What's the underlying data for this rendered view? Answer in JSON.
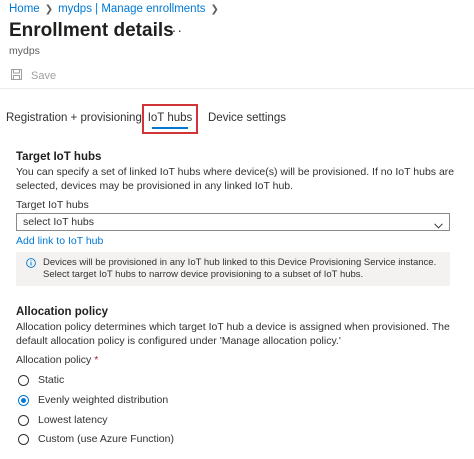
{
  "breadcrumb": {
    "home": "Home",
    "resource": "mydps | Manage enrollments"
  },
  "page": {
    "title": "Enrollment details",
    "more": "···",
    "subtitle": "mydps"
  },
  "toolbar": {
    "save_label": "Save"
  },
  "tabs": [
    {
      "label": "Registration + provisioning"
    },
    {
      "label": "IoT hubs",
      "selected": true
    },
    {
      "label": "Device settings"
    }
  ],
  "target_hubs": {
    "title": "Target IoT hubs",
    "description": "You can specify a set of linked IoT hubs where device(s) will be provisioned. If no IoT hubs are selected, devices may be provisioned in any linked IoT hub.",
    "field_label": "Target IoT hubs",
    "select_value": "select IoT hubs",
    "add_link": "Add link to IoT hub",
    "info": "Devices will be provisioned in any IoT hub linked to this Device Provisioning Service instance. Select target IoT hubs to narrow device provisioning to a subset of IoT hubs."
  },
  "allocation": {
    "title": "Allocation policy",
    "description": "Allocation policy determines which target IoT hub a device is assigned when provisioned. The default allocation policy is configured under 'Manage allocation policy.'",
    "field_label": "Allocation policy",
    "required_mark": "*",
    "options": [
      {
        "label": "Static",
        "checked": false
      },
      {
        "label": "Evenly weighted distribution",
        "checked": true
      },
      {
        "label": "Lowest latency",
        "checked": false
      },
      {
        "label": "Custom (use Azure Function)",
        "checked": false
      }
    ]
  },
  "colors": {
    "accent": "#0078d4",
    "highlight_border": "#d13438"
  }
}
